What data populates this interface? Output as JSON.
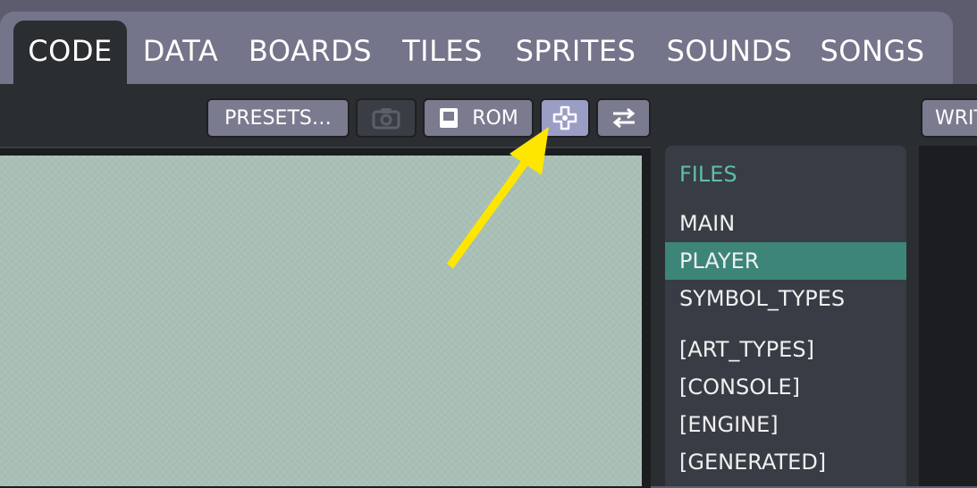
{
  "tabs": [
    {
      "label": "CODE",
      "active": true
    },
    {
      "label": "DATA",
      "active": false
    },
    {
      "label": "BOARDS",
      "active": false
    },
    {
      "label": "TILES",
      "active": false
    },
    {
      "label": "SPRITES",
      "active": false
    },
    {
      "label": "SOUNDS",
      "active": false
    },
    {
      "label": "SONGS",
      "active": false
    }
  ],
  "toolbar": {
    "presets_label": "PRESETS…",
    "camera_icon": "camera-icon",
    "rom_label": "ROM",
    "rom_icon": "rom-cartridge-icon",
    "gamepad_icon": "gamepad-icon",
    "swap_icon": "swap-arrows-icon",
    "write_label": "WRIT"
  },
  "files": {
    "header": "FILES",
    "items": [
      {
        "label": "MAIN",
        "selected": false
      },
      {
        "label": "PLAYER",
        "selected": true
      },
      {
        "label": "SYMBOL_TYPES",
        "selected": false
      },
      {
        "label": "[ART_TYPES]",
        "selected": false
      },
      {
        "label": "[CONSOLE]",
        "selected": false
      },
      {
        "label": "[ENGINE]",
        "selected": false
      },
      {
        "label": "[GENERATED]",
        "selected": false
      }
    ]
  },
  "annotation": {
    "arrow_color": "#ffe600"
  },
  "colors": {
    "accent_selected": "#3e8579",
    "files_header": "#5fbfa8",
    "tab_bg": "#74748a",
    "active_tab_bg": "#2b2e31"
  }
}
